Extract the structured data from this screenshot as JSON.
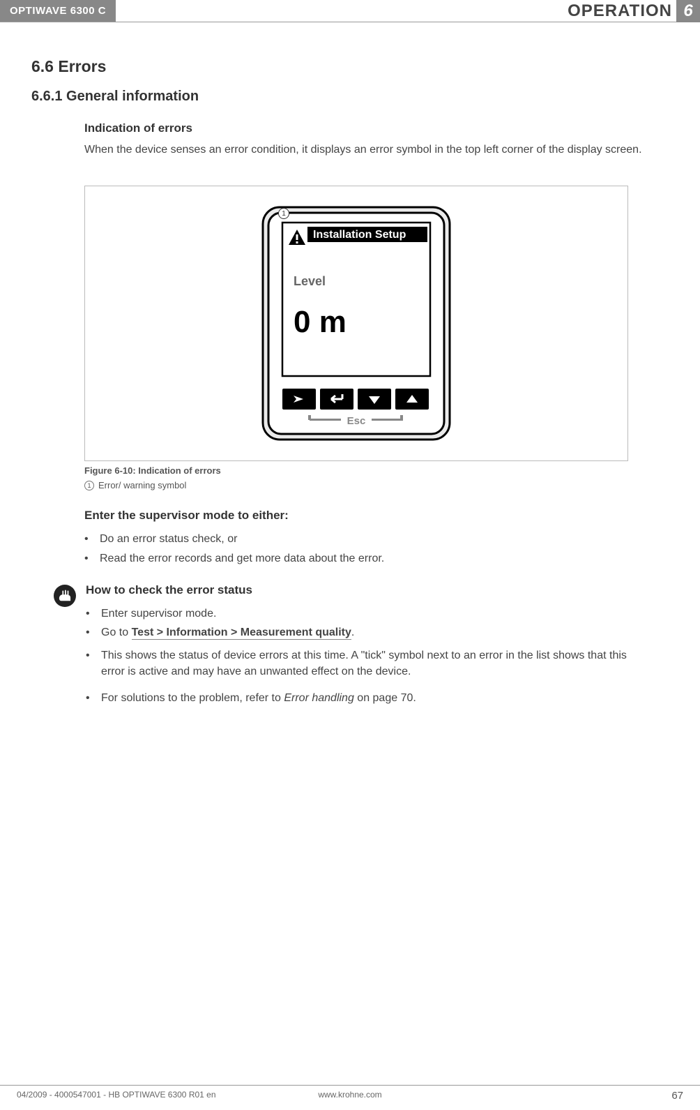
{
  "header": {
    "product": "OPTIWAVE 6300 C",
    "section_title": "OPERATION",
    "chapter": "6"
  },
  "headings": {
    "h2": "6.6  Errors",
    "h3": "6.6.1  General information",
    "h4a": "Indication of errors",
    "h4b": "Enter the supervisor mode to either:",
    "h4c": "How to check the error status"
  },
  "text": {
    "intro": "When the device senses an error condition, it displays an error symbol in the top left corner of the display screen.",
    "caption": "Figure 6-10: Indication of errors",
    "annot_label": "Error/ warning symbol",
    "annot_num": "1"
  },
  "device": {
    "header_label": "Installation Setup",
    "measure_label": "Level",
    "measure_value": "0 m",
    "esc_label": "Esc",
    "callout_num": "1"
  },
  "bullets_b": {
    "b1": "Do an error status check, or",
    "b2": "Read the error records and get more data about the error."
  },
  "bullets_c": {
    "c1": "Enter supervisor mode.",
    "c2_pre": "Go to ",
    "c2_bold": "Test > Information > Measurement quality",
    "c2_post": ".",
    "c3": "This shows the status of device errors at this time. A \"tick\" symbol next to an error in the list shows that this error is active and may have an unwanted effect on the device.",
    "c4_pre": "For solutions to the problem,  refer to ",
    "c4_italic": "Error handling",
    "c4_post": " on page 70."
  },
  "footer": {
    "left": "04/2009 - 4000547001 - HB OPTIWAVE 6300 R01 en",
    "center": "www.krohne.com",
    "right": "67"
  }
}
